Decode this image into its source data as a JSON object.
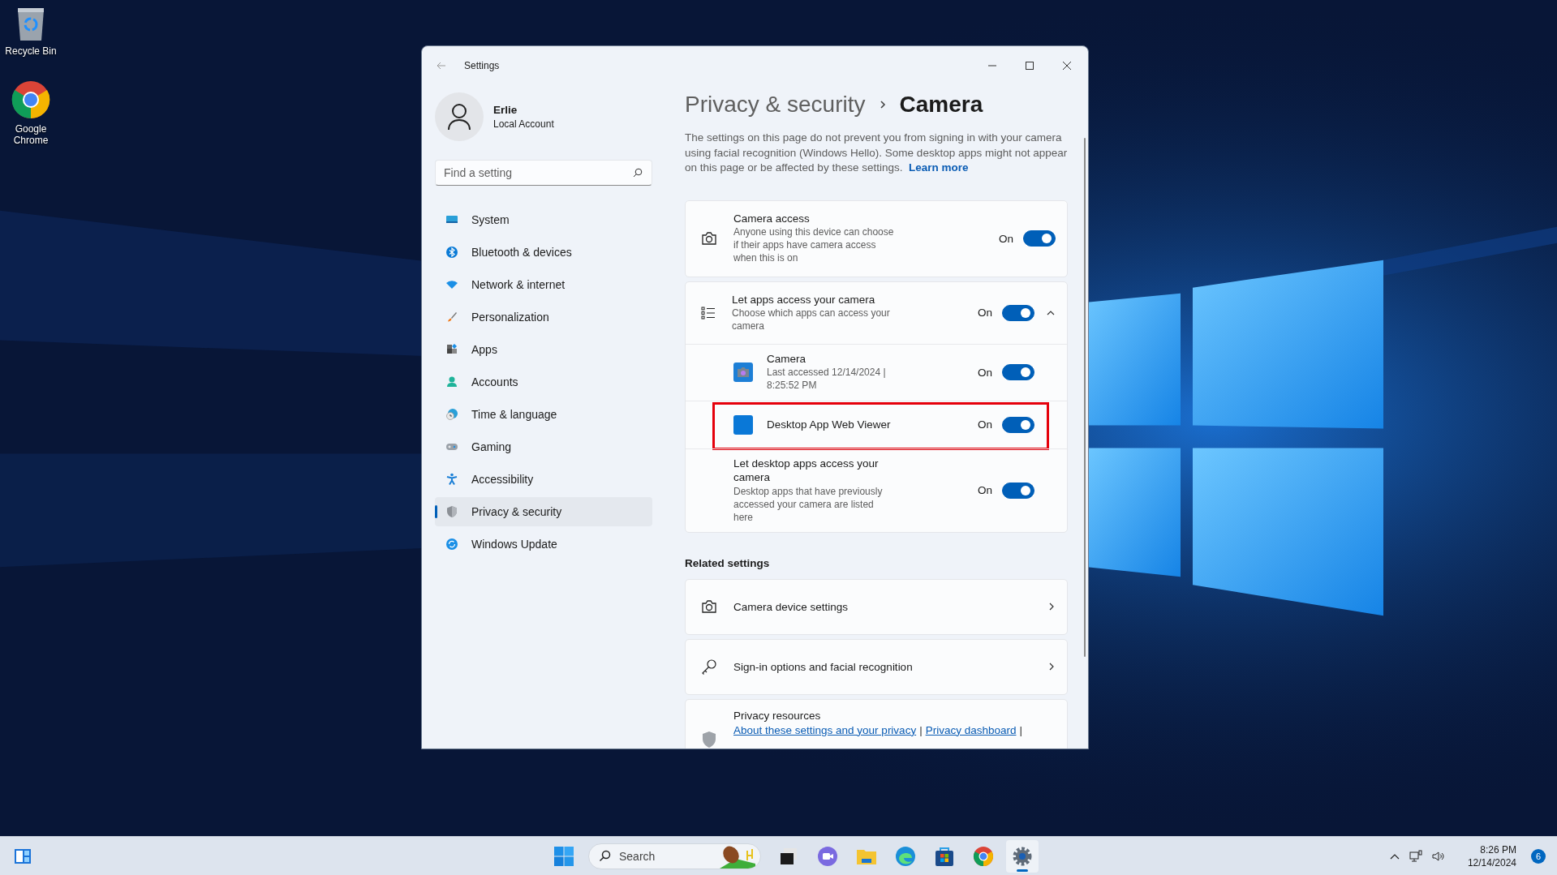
{
  "desktop_icons": [
    {
      "label": "Recycle Bin"
    },
    {
      "label": "Google Chrome"
    }
  ],
  "window": {
    "title": "Settings"
  },
  "account": {
    "name": "Erlie",
    "type": "Local Account"
  },
  "search": {
    "placeholder": "Find a setting"
  },
  "nav": [
    {
      "label": "System",
      "selected": false
    },
    {
      "label": "Bluetooth & devices",
      "selected": false
    },
    {
      "label": "Network & internet",
      "selected": false
    },
    {
      "label": "Personalization",
      "selected": false
    },
    {
      "label": "Apps",
      "selected": false
    },
    {
      "label": "Accounts",
      "selected": false
    },
    {
      "label": "Time & language",
      "selected": false
    },
    {
      "label": "Gaming",
      "selected": false
    },
    {
      "label": "Accessibility",
      "selected": false
    },
    {
      "label": "Privacy & security",
      "selected": true
    },
    {
      "label": "Windows Update",
      "selected": false
    }
  ],
  "breadcrumb": {
    "parent": "Privacy & security",
    "current": "Camera"
  },
  "description": {
    "text": "The settings on this page do not prevent you from signing in with your camera using facial recognition (Windows Hello). Some desktop apps might not appear on this page or be affected by these settings.",
    "link": "Learn more"
  },
  "camera_access": {
    "title": "Camera access",
    "description": "Anyone using this device can choose if their apps have camera access when this is on",
    "state_label": "On",
    "on": true
  },
  "app_access": {
    "title": "Let apps access your camera",
    "description": "Choose which apps can access your camera",
    "state_label": "On",
    "on": true,
    "expanded": true,
    "apps": [
      {
        "name": "Camera",
        "detail": "Last accessed 12/14/2024 | 8:25:52 PM",
        "state_label": "On",
        "on": true,
        "highlighted": false
      },
      {
        "name": "Desktop App Web Viewer",
        "state_label": "On",
        "on": true,
        "highlighted": true
      }
    ],
    "desktop_apps": {
      "title": "Let desktop apps access your camera",
      "description": "Desktop apps that have previously accessed your camera are listed here",
      "state_label": "On",
      "on": true
    }
  },
  "related": {
    "heading": "Related settings",
    "items": [
      {
        "label": "Camera device settings"
      },
      {
        "label": "Sign-in options and facial recognition"
      }
    ],
    "resources": {
      "title": "Privacy resources",
      "links": [
        "About these settings and your privacy",
        "Privacy dashboard"
      ],
      "separator": "|"
    }
  },
  "taskbar": {
    "search_placeholder": "Search",
    "pinned": [
      {
        "kind": "taskview",
        "selected": false
      },
      {
        "kind": "chat",
        "selected": false
      },
      {
        "kind": "explorer",
        "selected": false
      },
      {
        "kind": "edge",
        "selected": false
      },
      {
        "kind": "store",
        "selected": false
      },
      {
        "kind": "chrome",
        "selected": false
      },
      {
        "kind": "settings",
        "selected": true
      }
    ],
    "time": "8:26 PM",
    "date": "12/14/2024",
    "notifications": "6"
  }
}
